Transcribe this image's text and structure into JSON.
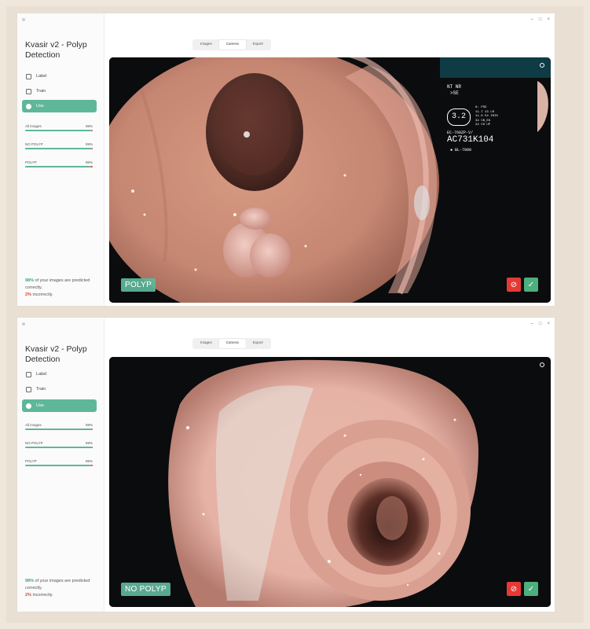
{
  "windows": [
    {
      "app_title": "Kvasir v2 - Polyp Detection",
      "nav": [
        {
          "label": "Label",
          "icon": "label-icon"
        },
        {
          "label": "Train",
          "icon": "train-icon"
        },
        {
          "label": "Use",
          "icon": "use-icon"
        }
      ],
      "stats": [
        {
          "label": "All images",
          "value": "98%",
          "fraction": 0.98
        },
        {
          "label": "NO POLYP",
          "value": "99%",
          "fraction": 0.99
        },
        {
          "label": "POLYP",
          "value": "96%",
          "fraction": 0.96
        }
      ],
      "summary": {
        "correct_pct": "98%",
        "correct_text": " of your images are predicted correctly.",
        "incorrect_pct": "2%",
        "incorrect_text": " incorrectly."
      },
      "tabs": [
        "Images",
        "Camera",
        "Export"
      ],
      "active_tab": "Camera",
      "prediction": "POLYP",
      "overlay": {
        "line1": "NT NR",
        "line2": ">SE",
        "zoom": "3.2",
        "info": [
          "6: FRZ",
          "11.7 13 LR",
          "11.6 54 IRIS",
          "34 CB_E6",
          "24 CH UP"
        ],
        "model": "EC-760ZP-V/",
        "serial": "AC731K104",
        "light": "BL-7000"
      }
    },
    {
      "app_title": "Kvasir v2 - Polyp Detection",
      "nav": [
        {
          "label": "Label",
          "icon": "label-icon"
        },
        {
          "label": "Train",
          "icon": "train-icon"
        },
        {
          "label": "Use",
          "icon": "use-icon"
        }
      ],
      "stats": [
        {
          "label": "All images",
          "value": "98%",
          "fraction": 0.98
        },
        {
          "label": "NO POLYP",
          "value": "99%",
          "fraction": 0.99
        },
        {
          "label": "POLYP",
          "value": "96%",
          "fraction": 0.96
        }
      ],
      "summary": {
        "correct_pct": "98%",
        "correct_text": " of your images are predicted correctly.",
        "incorrect_pct": "2%",
        "incorrect_text": " incorrectly."
      },
      "tabs": [
        "Images",
        "Camera",
        "Export"
      ],
      "active_tab": "Camera",
      "prediction": "NO POLYP"
    }
  ],
  "window_controls": [
    "–",
    "□",
    "×"
  ],
  "colors": {
    "accent": "#5fb79a",
    "reject": "#e53935",
    "accept": "#4caf7d",
    "error": "#d8433a"
  }
}
